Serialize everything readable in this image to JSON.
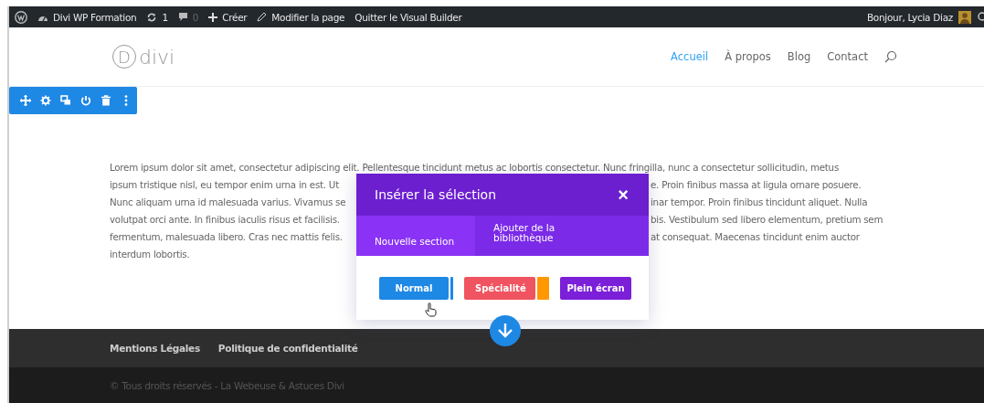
{
  "admin_bar": {
    "items": [
      {
        "kind": "wp"
      },
      {
        "kind": "site",
        "label": "Divi WP Formation"
      },
      {
        "kind": "updates",
        "label": "1"
      },
      {
        "kind": "comments",
        "label": "0"
      },
      {
        "kind": "new",
        "label": "Créer"
      },
      {
        "kind": "edit",
        "label": "Modifier la page"
      },
      {
        "kind": "exit",
        "label": "Quitter le Visual Builder"
      }
    ],
    "greeting": "Bonjour, Lycia Diaz"
  },
  "header": {
    "logo_letter": "D",
    "logo_text": "divi",
    "nav": [
      {
        "label": "Accueil",
        "selected": true
      },
      {
        "label": "À propos",
        "selected": false
      },
      {
        "label": "Blog",
        "selected": false
      },
      {
        "label": "Contact",
        "selected": false
      }
    ]
  },
  "paragraph": {
    "lines": [
      {
        "left": "Lorem ipsum dolor sit amet, consectetur adipiscing elit. Pellentesque tincidunt metus ac lobortis consectetur. Nunc fringilla, nunc a consectetur sollicitudin, metus"
      },
      {
        "left": "ipsum tristique nisl, eu tempor enim urna in est. Ut",
        "right": "e. Proin finibus massa at ligula ornare posuere."
      },
      {
        "left": "Nunc aliquam urna id malesuada varius. Vivamus se",
        "right": "inar tempor. Proin finibus tincidunt aliquet. Nulla"
      },
      {
        "left": "volutpat orci ante. In finibus iaculis risus et facilisis.",
        "right": "bis. Vestibulum sed libero elementum, pretium sem"
      },
      {
        "left": "fermentum, malesuada libero. Cras nec mattis felis.",
        "right": "at consequat. Maecenas tincidunt enim auctor"
      },
      {
        "left": "interdum lobortis."
      }
    ]
  },
  "modal": {
    "title": "Insérer la sélection",
    "close": "×",
    "tabs": [
      {
        "label": "Nouvelle section",
        "selected": true
      },
      {
        "label": "Ajouter de la bibliothèque",
        "selected": false
      }
    ],
    "buttons": [
      {
        "label": "Normal",
        "kind": "normal"
      },
      {
        "label": "Spécialité",
        "kind": "specialty"
      },
      {
        "label": "Plein écran",
        "kind": "fullwidth"
      }
    ]
  },
  "footer": {
    "links": [
      "Mentions Légales",
      "Politique de confidentialité"
    ],
    "copyright": "© Tous droits réservés - La Webeuse & Astuces Divi"
  }
}
